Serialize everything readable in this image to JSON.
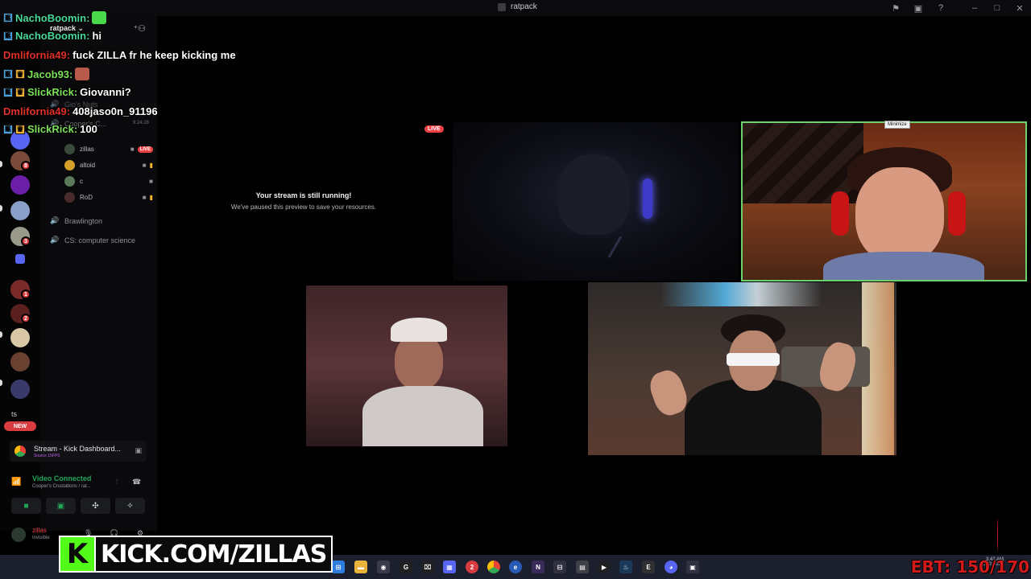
{
  "window": {
    "title": "ratpack"
  },
  "server": {
    "name": "ratpack"
  },
  "rail": {
    "badges": [
      "8",
      "3",
      "1",
      "2"
    ],
    "new_label": "NEW",
    "ts_label": "ts"
  },
  "channels": {
    "faded_top": "Gio's Nuts",
    "cooper": "Cooper's C...",
    "cooper_time": "9:24:28",
    "brawlington": "Brawlington",
    "cs": "CS: computer science",
    "voice_users": [
      {
        "name": "zillas",
        "live": "LIVE",
        "avatar_color": "#3a4a3a"
      },
      {
        "name": "altoid",
        "avatar_color": "#d4a02a"
      },
      {
        "name": "c",
        "avatar_color": "#5a7a5a"
      },
      {
        "name": "RoD",
        "avatar_color": "#4a2a2a"
      }
    ]
  },
  "stream_card": {
    "title": "Stream - Kick Dashboard...",
    "subtitle": "Source 15FPS"
  },
  "voice_status": {
    "status": "Video Connected",
    "channel": "Cooper's Crustations / rat..."
  },
  "user": {
    "name": "zillas",
    "status": "Invisible"
  },
  "stage": {
    "live_badge": "LIVE",
    "paused_heading": "Your stream is still running!",
    "paused_body": "We've paused this preview to save your resources.",
    "minimize_tooltip": "Minimize"
  },
  "chat": [
    {
      "user": "NachoBoomin:",
      "text": "",
      "color": "#4ad99a"
    },
    {
      "user": "NachoBoomin:",
      "text": "hi",
      "color": "#4ad99a"
    },
    {
      "user": "Dmlifornia49:",
      "text": "fuck ZILLA fr he keep kicking me",
      "color": "#e0302a"
    },
    {
      "user": "Jacob93:",
      "text": "",
      "color": "#7be05a"
    },
    {
      "user": "SlickRick:",
      "text": "Giovanni?",
      "color": "#7be05a"
    },
    {
      "user": "Dmlifornia49:",
      "text": "408jaso0n_91196",
      "color": "#e0302a"
    },
    {
      "user": "SlickRick:",
      "text": "100",
      "color": "#7be05a"
    }
  ],
  "overlay": {
    "kick_logo": "K",
    "kick_url": "KICK.COM/ZILLAS",
    "ebt": "EBT: 150/170"
  },
  "taskbar": {
    "clock_time": "3:42 AM",
    "clock_date": "11/22/2024"
  },
  "colors": {
    "accent_live": "#ed4245",
    "voice_green": "#23a55a",
    "kick_green": "#53fc18",
    "tile_border": "#6bd26b"
  }
}
